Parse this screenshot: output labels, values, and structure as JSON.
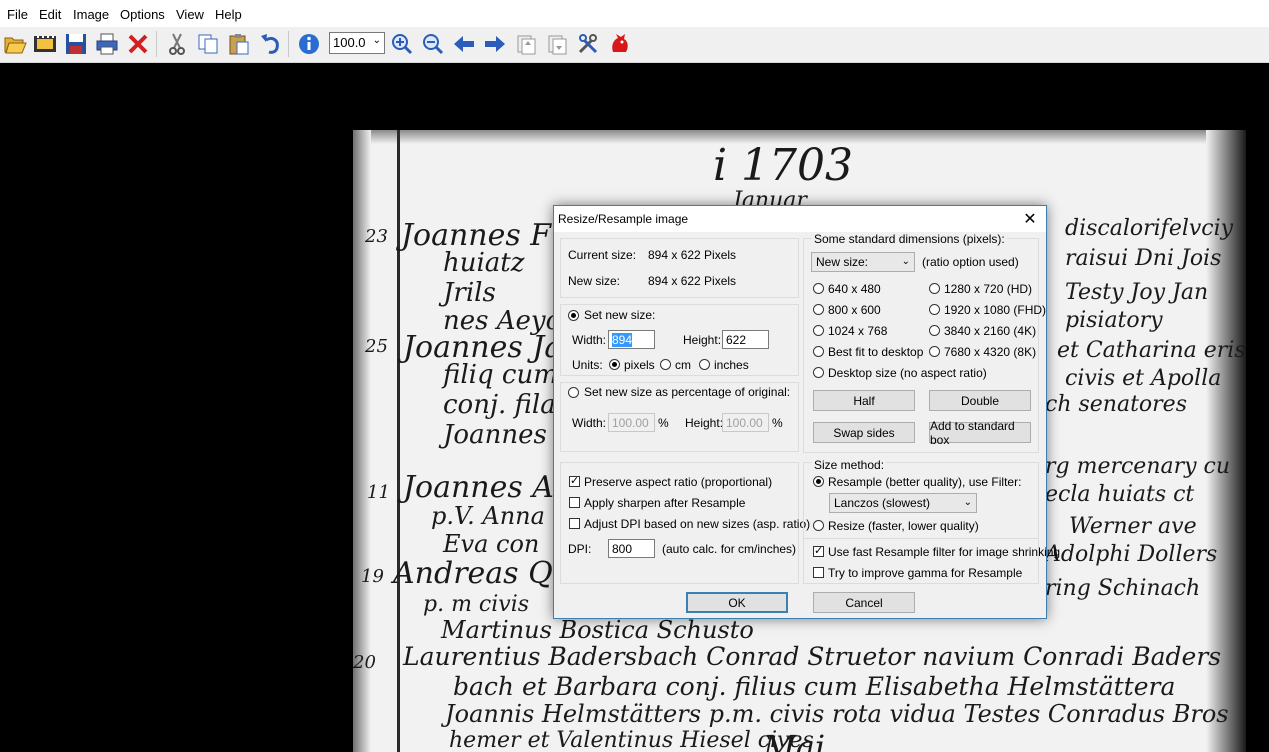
{
  "menu": [
    "File",
    "Edit",
    "Image",
    "Options",
    "View",
    "Help"
  ],
  "toolbar": {
    "icons": [
      "open-folder-icon",
      "slideshow-icon",
      "save-icon",
      "print-icon",
      "delete-icon",
      "cut-icon",
      "copy-icon",
      "paste-icon",
      "undo-icon",
      "info-icon",
      "zoom-in-icon",
      "zoom-out-icon",
      "previous-icon",
      "next-icon",
      "page-up-icon",
      "page-down-icon",
      "settings-icon",
      "irfanview-logo-icon"
    ],
    "zoom_value": "100.0"
  },
  "document": {
    "lines": [
      "i 1703",
      "Januar",
      "Joannes Fre",
      "huiatz",
      "Jrils",
      "nes Aeyo",
      "Joannes Jahn",
      "filiq cum",
      "conj. fila",
      "Joannes",
      "Joannes Ad",
      "p.V. Anna",
      "Eva con",
      "Andreas Qu",
      "p. m civis",
      "Martinus Bostica Schusto",
      "Laurentius Badersbach Conrad Struetor navium Conradi Baders",
      "bach et Barbara conj. filius cum Elisabetha Helmstättera",
      "Joannis Helmstätters p.m. civis rota vidua Testes Conradus Bros",
      "hemer et Valentinus Hiesel cives",
      "Mai",
      "discalorifelvciy",
      "raisui Dni Jois",
      "Testy Joy Jan",
      "pisiatory",
      "et Catharina eris",
      "civis et Apolla",
      "ch senatores",
      "rg mercenary cu",
      "ecla huiats ct",
      "Werner ave",
      "Adolphi Dollers",
      "ring Schinach",
      "23",
      "25",
      "11",
      "19",
      "20"
    ]
  },
  "dialog": {
    "title": "Resize/Resample image",
    "current_size_label": "Current size:",
    "current_size_value": "894  x  622  Pixels",
    "new_size_label": "New size:",
    "new_size_value": "894  x  622  Pixels",
    "set_new_size": "Set new size:",
    "width_label": "Width:",
    "width_value": "894",
    "height_label": "Height:",
    "height_value": "622",
    "units_label": "Units:",
    "unit_pixels": "pixels",
    "unit_cm": "cm",
    "unit_inches": "inches",
    "set_percentage": "Set new size as percentage of original:",
    "pct_width_label": "Width:",
    "pct_width_value": "100.00",
    "pct_height_label": "Height:",
    "pct_height_value": "100.00",
    "percent_sign": "%",
    "preserve_aspect": "Preserve aspect ratio (proportional)",
    "apply_sharpen": "Apply sharpen after Resample",
    "adjust_dpi": "Adjust DPI based on new sizes (asp. ratio)",
    "dpi_label": "DPI:",
    "dpi_value": "800",
    "dpi_note": "(auto calc. for cm/inches)",
    "std_dims_label": "Some standard dimensions (pixels):",
    "std_dropdown": "New size:",
    "ratio_note": "(ratio option used)",
    "std_options": [
      "640 x 480",
      "800 x 600",
      "1024 x 768",
      "Best fit to desktop",
      "Desktop size (no aspect ratio)",
      "1280 x 720   (HD)",
      "1920 x 1080 (FHD)",
      "3840 x 2160 (4K)",
      "7680 x 4320 (8K)"
    ],
    "half_btn": "Half",
    "double_btn": "Double",
    "swap_btn": "Swap sides",
    "add_std_btn": "Add to standard box",
    "size_method_label": "Size method:",
    "resample_label": "Resample (better quality), use Filter:",
    "filter_value": "Lanczos (slowest)",
    "resize_label": "Resize (faster, lower quality)",
    "fast_resample": "Use fast Resample filter for image shrinking",
    "improve_gamma": "Try to improve gamma for Resample",
    "ok_btn": "OK",
    "cancel_btn": "Cancel"
  }
}
